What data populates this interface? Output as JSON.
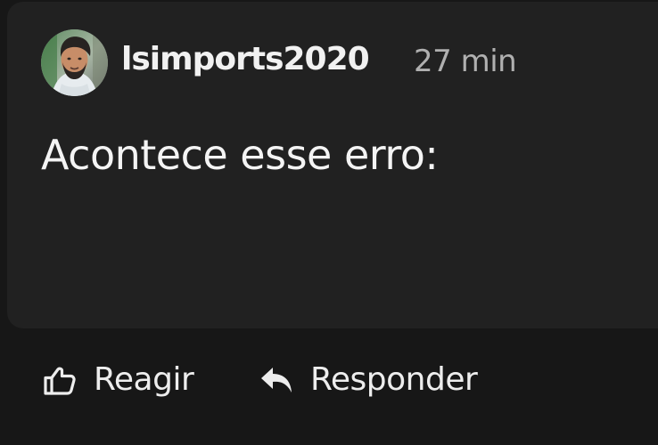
{
  "comment": {
    "author": "lsimports2020",
    "time": "27 min",
    "text": "Acontece esse erro:",
    "avatar_icon": "user-avatar-photo"
  },
  "actions": {
    "react": {
      "label": "Reagir",
      "icon": "thumbs-up-icon"
    },
    "reply": {
      "label": "Responder",
      "icon": "reply-arrow-icon"
    }
  },
  "colors": {
    "page_background": "#171717",
    "card_background": "#212121",
    "primary_text": "#f1f1f1",
    "secondary_text": "#b0b0b0"
  }
}
